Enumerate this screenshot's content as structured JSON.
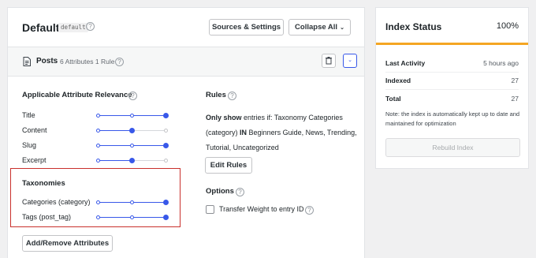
{
  "engine": {
    "title": "Default",
    "slug": "default",
    "help_glyph": "?",
    "sources_settings_label": "Sources & Settings",
    "collapse_all_label": "Collapse All",
    "collapse_icon": "chevron-down-icon"
  },
  "source": {
    "name": "Posts",
    "meta": "6 Attributes 1 Rule",
    "icon": "document-icon",
    "trash_icon": "trash-icon",
    "toggle_icon": "chevron-down-icon",
    "toggle_glyph": "⌄"
  },
  "relevance": {
    "title": "Applicable Attribute Relevance",
    "attributes": [
      {
        "label": "Title",
        "value": 1.0
      },
      {
        "label": "Content",
        "value": 0.5
      },
      {
        "label": "Slug",
        "value": 1.0
      },
      {
        "label": "Excerpt",
        "value": 0.5
      }
    ]
  },
  "taxonomies": {
    "title": "Taxonomies",
    "items": [
      {
        "label": "Categories (category)",
        "value": 1.0
      },
      {
        "label": "Tags (post_tag)",
        "value": 1.0
      }
    ]
  },
  "add_remove_label": "Add/Remove Attributes",
  "rules": {
    "title": "Rules",
    "only_show": "Only show",
    "rule_prefix": "entries if: Taxonomy Categories (category)",
    "in_keyword": "IN",
    "rule_values": "Beginners Guide, News, Trending, Tutorial, Uncategorized",
    "edit_label": "Edit Rules"
  },
  "options": {
    "title": "Options",
    "transfer_weight_label": "Transfer Weight to entry ID",
    "transfer_weight_checked": false
  },
  "index_status": {
    "title": "Index Status",
    "percent": "100%",
    "progress": 1.0,
    "progress_color": "#f5a623",
    "last_activity_label": "Last Activity",
    "last_activity_value": "5 hours ago",
    "indexed_label": "Indexed",
    "indexed_value": "27",
    "total_label": "Total",
    "total_value": "27",
    "note": "Note: the index is automatically kept up to date and maintained for optimization",
    "rebuild_label": "Rebuild Index"
  },
  "colors": {
    "accent": "#3858e9",
    "highlight_border": "#c9302c"
  }
}
